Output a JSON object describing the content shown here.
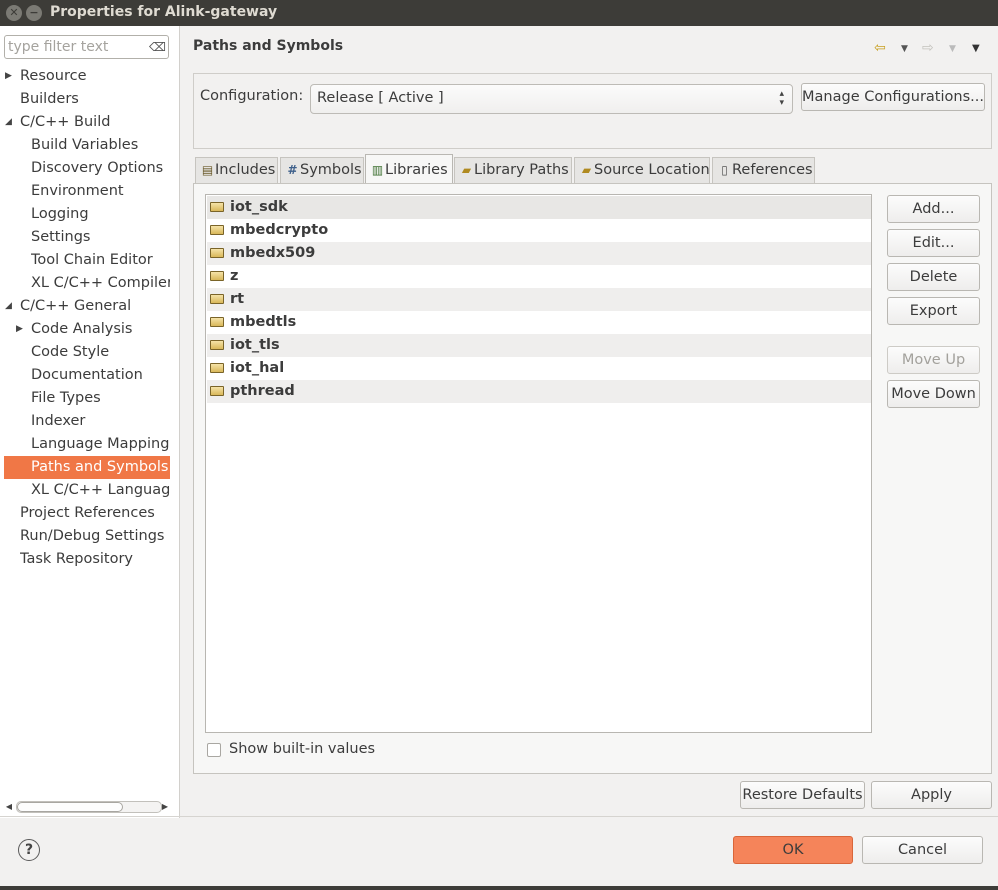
{
  "window": {
    "title": "Properties for Alink-gateway",
    "close_glyph": "✕",
    "minimize_glyph": "−"
  },
  "filter": {
    "placeholder": "type filter text"
  },
  "tree": [
    {
      "label": "Resource",
      "expandable": true
    },
    {
      "label": "Builders"
    },
    {
      "label": "C/C++ Build",
      "expanded": true
    },
    {
      "label": "Build Variables"
    },
    {
      "label": "Discovery Options"
    },
    {
      "label": "Environment"
    },
    {
      "label": "Logging"
    },
    {
      "label": "Settings"
    },
    {
      "label": "Tool Chain Editor"
    },
    {
      "label": "XL C/C++ Compiler"
    },
    {
      "label": "C/C++ General",
      "expanded": true
    },
    {
      "label": "Code Analysis",
      "expandable": true
    },
    {
      "label": "Code Style"
    },
    {
      "label": "Documentation"
    },
    {
      "label": "File Types"
    },
    {
      "label": "Indexer"
    },
    {
      "label": "Language Mappings"
    },
    {
      "label": "Paths and Symbols",
      "selected": true
    },
    {
      "label": "XL C/C++ Language C"
    },
    {
      "label": "Project References"
    },
    {
      "label": "Run/Debug Settings"
    },
    {
      "label": "Task Repository"
    }
  ],
  "page": {
    "title": "Paths and Symbols"
  },
  "configuration": {
    "label": "Configuration:",
    "value": "Release  [ Active ]",
    "manage_button": "Manage Configurations..."
  },
  "tabs": [
    {
      "label": "Includes",
      "icon": "includes-icon"
    },
    {
      "label": "Symbols",
      "icon": "hash-icon"
    },
    {
      "label": "Libraries",
      "icon": "libraries-icon",
      "active": true
    },
    {
      "label": "Library Paths",
      "icon": "library-paths-icon"
    },
    {
      "label": "Source Location",
      "icon": "source-location-icon"
    },
    {
      "label": "References",
      "icon": "references-icon"
    }
  ],
  "libraries": [
    "iot_sdk",
    "mbedcrypto",
    "mbedx509",
    "z",
    "rt",
    "mbedtls",
    "iot_tls",
    "iot_hal",
    "pthread"
  ],
  "side_buttons": {
    "add": "Add...",
    "edit": "Edit...",
    "delete": "Delete",
    "export": "Export",
    "move_up": "Move Up",
    "move_down": "Move Down"
  },
  "show_builtin": {
    "label": "Show built-in values",
    "checked": false
  },
  "footer": {
    "restore_defaults": "Restore Defaults",
    "apply": "Apply",
    "ok": "OK",
    "cancel": "Cancel",
    "help": "?"
  },
  "colors": {
    "accent": "#f07746",
    "titlebar": "#3d3c38"
  }
}
